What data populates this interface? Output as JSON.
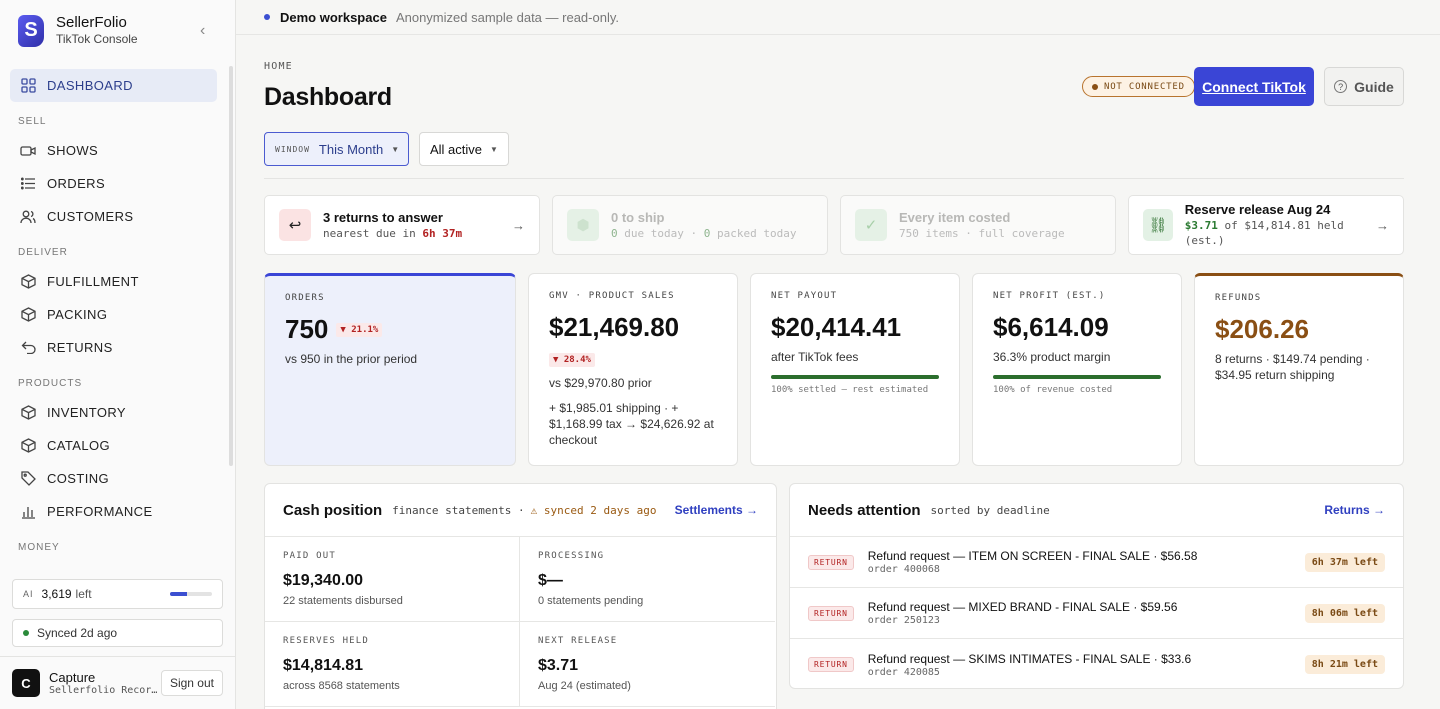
{
  "brand": {
    "name": "SellerFolio",
    "sub": "TikTok Console",
    "logo_letter": "S",
    "accent": "#3a45d6"
  },
  "sidebar": {
    "items": [
      {
        "label": "DASHBOARD",
        "icon": "grid-icon"
      },
      {
        "section": "SELL"
      },
      {
        "label": "SHOWS",
        "icon": "video-icon"
      },
      {
        "label": "ORDERS",
        "icon": "list-icon"
      },
      {
        "label": "CUSTOMERS",
        "icon": "users-icon"
      },
      {
        "section": "DELIVER"
      },
      {
        "label": "FULFILLMENT",
        "icon": "box-icon"
      },
      {
        "label": "PACKING",
        "icon": "box-icon"
      },
      {
        "label": "RETURNS",
        "icon": "return-icon"
      },
      {
        "section": "PRODUCTS"
      },
      {
        "label": "INVENTORY",
        "icon": "box-icon"
      },
      {
        "label": "CATALOG",
        "icon": "book-icon"
      },
      {
        "label": "COSTING",
        "icon": "tag-icon"
      },
      {
        "label": "PERFORMANCE",
        "icon": "bar-chart-icon"
      },
      {
        "section": "MONEY"
      }
    ],
    "ai": {
      "label": "AI",
      "value": "3,619",
      "suffix": "left",
      "fill": 0.4
    },
    "sync": "Synced 2d ago",
    "user": {
      "initial": "C",
      "name": "Capture",
      "sub": "Sellerfolio Recor…",
      "signout": "Sign out"
    }
  },
  "demo": {
    "title": "Demo workspace",
    "note": "Anonymized sample data — read-only."
  },
  "header": {
    "crumb": "HOME",
    "title": "Dashboard",
    "badge": "NOT CONNECTED",
    "connect": "Connect TikTok",
    "guide": "Guide",
    "window_label": "WINDOW",
    "window_value": "This Month",
    "filter_value": "All active"
  },
  "alerts": [
    {
      "icon": "↩",
      "title": "3 returns to answer",
      "sub_a": "nearest due in ",
      "sub_b": "6h 37m",
      "arrow": "→"
    },
    {
      "icon": "⬢",
      "title": "0 to ship",
      "sub_a": "0",
      "sub_b": " due today · ",
      "sub_c": "0",
      "sub_d": " packed today"
    },
    {
      "icon": "✓",
      "title": "Every item costed",
      "sub": "750 items · full coverage"
    },
    {
      "icon": "⛓",
      "title": "Reserve release Aug 24",
      "sub_a": "$3.71",
      "sub_b": " of $14,814.81 held (est.)",
      "arrow": "→"
    }
  ],
  "metrics": [
    {
      "label": "ORDERS",
      "value": "750",
      "delta": "▼ 21.1%",
      "sub": "vs 950 in the prior period"
    },
    {
      "label": "GMV · PRODUCT SALES",
      "value": "$21,469.80",
      "delta": "▼ 28.4%",
      "sub": "vs $29,970.80 prior",
      "extra": "+ $1,985.01 shipping · + $1,168.99 tax → $24,626.92 at checkout"
    },
    {
      "label": "NET PAYOUT",
      "value": "$20,414.41",
      "sub": "after TikTok fees",
      "progress": 1.0,
      "note": "100% settled — rest estimated"
    },
    {
      "label": "NET PROFIT (EST.)",
      "value": "$6,614.09",
      "sub": "36.3% product margin",
      "progress": 1.0,
      "note": "100% of revenue costed"
    },
    {
      "label": "REFUNDS",
      "value": "$206.26",
      "sub": "8 returns · $149.74 pending · $34.95 return shipping"
    }
  ],
  "cash": {
    "title": "Cash position",
    "meta": "finance statements ·",
    "warn": "⚠ synced 2 days ago",
    "link": "Settlements →",
    "cells": [
      {
        "label": "PAID OUT",
        "value": "$19,340.00",
        "sub": "22 statements disbursed"
      },
      {
        "label": "PROCESSING",
        "value": "$—",
        "sub": "0 statements pending"
      },
      {
        "label": "RESERVES HELD",
        "value": "$14,814.81",
        "sub": "across 8568 statements"
      },
      {
        "label": "NEXT RELEASE",
        "value": "$3.71",
        "sub": "Aug 24 (estimated)"
      }
    ]
  },
  "attention": {
    "title": "Needs attention",
    "meta": "sorted by deadline",
    "link": "Returns →",
    "rows": [
      {
        "tag": "RETURN",
        "title": "Refund request — ITEM ON SCREEN - FINAL SALE · $56.58",
        "order": "order 400068",
        "due": "6h 37m left"
      },
      {
        "tag": "RETURN",
        "title": "Refund request — MIXED BRAND - FINAL SALE · $59.56",
        "order": "order 250123",
        "due": "8h 06m left"
      },
      {
        "tag": "RETURN",
        "title": "Refund request — SKIMS INTIMATES - FINAL SALE · $33.6",
        "order": "order 420085",
        "due": "8h 21m left"
      }
    ]
  }
}
